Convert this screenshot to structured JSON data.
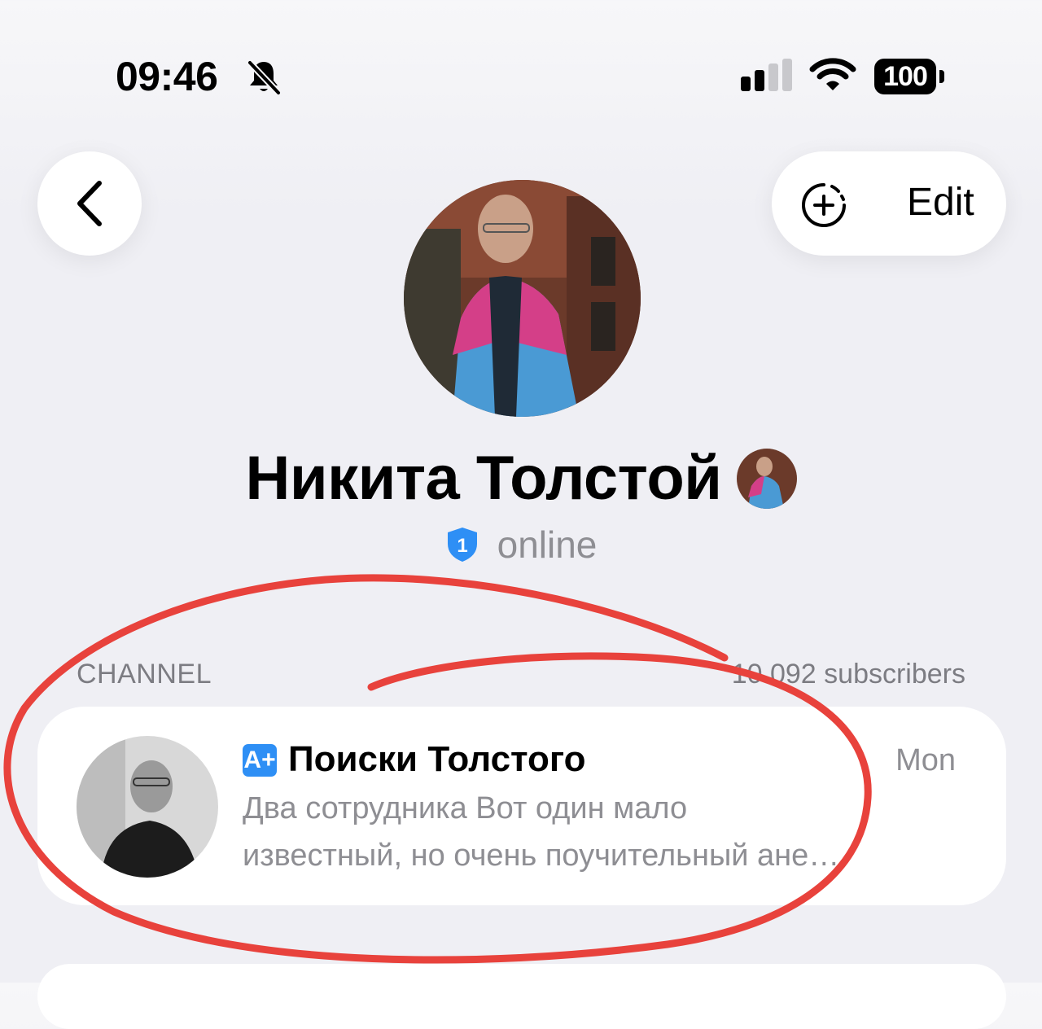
{
  "status_bar": {
    "time": "09:46",
    "battery": "100",
    "icons": [
      "bell-slash-icon",
      "cellular-signal-icon",
      "wifi-icon",
      "battery-icon"
    ]
  },
  "nav": {
    "back_icon": "chevron-left-icon",
    "add_icon": "add-story-icon",
    "edit_label": "Edit"
  },
  "profile": {
    "name": "Никита Толстой",
    "verified_badge": "1",
    "status": "online"
  },
  "channel_section": {
    "header": "CHANNEL",
    "subscribers": "10 092 subscribers"
  },
  "channel": {
    "badge": "A+",
    "title": "Поиски Толстого",
    "time": "Mon",
    "preview_line1": "Два сотрудника Вот один мало",
    "preview_line2": "известный, но очень поучительный ане…"
  },
  "colors": {
    "accent": "#2e8ff5",
    "annotation": "#e8423c",
    "secondary_text": "#8e8e93",
    "background": "#efeff4"
  }
}
